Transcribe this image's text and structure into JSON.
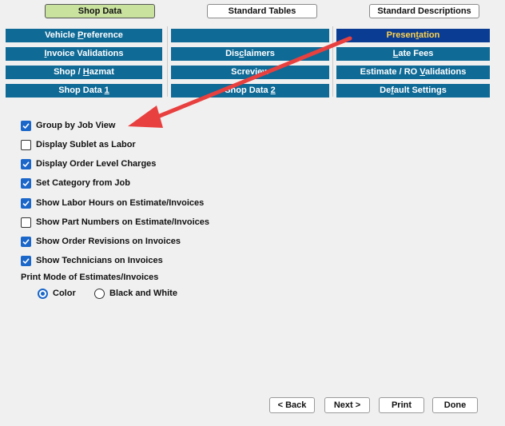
{
  "top_tabs": [
    {
      "label": "Shop Data",
      "active": true
    },
    {
      "label": "Standard Tables",
      "active": false
    },
    {
      "label": "Standard Descriptions",
      "active": false
    }
  ],
  "sub_tabs": {
    "col1": [
      {
        "pre": "Vehicle ",
        "u": "P",
        "post": "reference"
      },
      {
        "pre": "",
        "u": "I",
        "post": "nvoice Validations"
      },
      {
        "pre": "Shop / ",
        "u": "H",
        "post": "azmat"
      },
      {
        "pre": "Shop Data ",
        "u": "1",
        "post": ""
      }
    ],
    "col2": [
      {
        "pre": "",
        "u": "",
        "post": ""
      },
      {
        "pre": "Dis",
        "u": "c",
        "post": "laimers"
      },
      {
        "pre": "Scre",
        "u": "",
        "post": "view"
      },
      {
        "pre": "Shop Data ",
        "u": "2",
        "post": ""
      }
    ],
    "col3": [
      {
        "pre": "Presen",
        "u": "t",
        "post": "ation"
      },
      {
        "pre": "",
        "u": "L",
        "post": "ate Fees"
      },
      {
        "pre": "Estimate / RO ",
        "u": "V",
        "post": "alidations"
      },
      {
        "pre": "De",
        "u": "f",
        "post": "ault Settings"
      }
    ]
  },
  "options": [
    {
      "label": "Group by Job View",
      "checked": true
    },
    {
      "label": "Display Sublet as Labor",
      "checked": false
    },
    {
      "label": "Display Order Level Charges",
      "checked": true
    },
    {
      "label": "Set Category from Job",
      "checked": true
    },
    {
      "label": "Show Labor Hours on Estimate/Invoices",
      "checked": true
    },
    {
      "label": "Show Part Numbers on Estimate/Invoices",
      "checked": false
    },
    {
      "label": "Show Order Revisions on Invoices",
      "checked": true
    },
    {
      "label": "Show Technicians on Invoices",
      "checked": true
    }
  ],
  "print_mode": {
    "label": "Print Mode of Estimates/Invoices",
    "options": [
      {
        "label": "Color",
        "selected": true
      },
      {
        "label": "Black and White",
        "selected": false
      }
    ]
  },
  "buttons": {
    "back": "< Back",
    "next": "Next >",
    "print": "Print",
    "done": "Done"
  },
  "colors": {
    "tab_blue": "#0f6a96",
    "tab_active": "#0a3c94",
    "tab_active_text": "#ffd34d",
    "top_tab_active": "#c9e29e",
    "check_blue": "#1a66c9",
    "arrow_red": "#e8403f"
  }
}
